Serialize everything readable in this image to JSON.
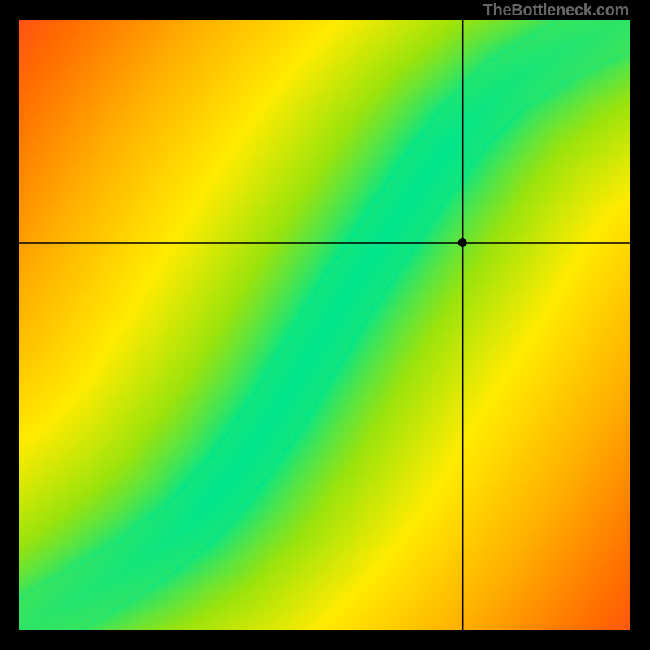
{
  "attribution": "TheBottleneck.com",
  "chart_data": {
    "type": "heatmap",
    "title": "",
    "xlabel": "",
    "ylabel": "",
    "xlim": [
      0,
      1
    ],
    "ylim": [
      0,
      1
    ],
    "marker": {
      "x": 0.725,
      "y": 0.635
    },
    "crosshair": {
      "x": 0.725,
      "y": 0.635
    },
    "ridge": {
      "description": "Optimal-balance curve (green) running roughly diagonally with an S-curve; scalar field is distance from this ridge, colored red→orange→yellow→green.",
      "points_norm": [
        [
          0.0,
          0.0
        ],
        [
          0.1,
          0.055
        ],
        [
          0.2,
          0.115
        ],
        [
          0.28,
          0.175
        ],
        [
          0.35,
          0.255
        ],
        [
          0.42,
          0.355
        ],
        [
          0.48,
          0.455
        ],
        [
          0.54,
          0.555
        ],
        [
          0.6,
          0.645
        ],
        [
          0.66,
          0.735
        ],
        [
          0.72,
          0.815
        ],
        [
          0.8,
          0.895
        ],
        [
          0.9,
          0.955
        ],
        [
          1.0,
          1.0
        ]
      ],
      "band_half_width_norm": 0.045
    },
    "color_stops": [
      {
        "t": 0.0,
        "hex": "#00e58b"
      },
      {
        "t": 0.18,
        "hex": "#9be30b"
      },
      {
        "t": 0.35,
        "hex": "#ffeb00"
      },
      {
        "t": 0.55,
        "hex": "#ffb100"
      },
      {
        "t": 0.75,
        "hex": "#ff6a00"
      },
      {
        "t": 1.0,
        "hex": "#ff1744"
      }
    ],
    "grid_resolution": 160
  }
}
